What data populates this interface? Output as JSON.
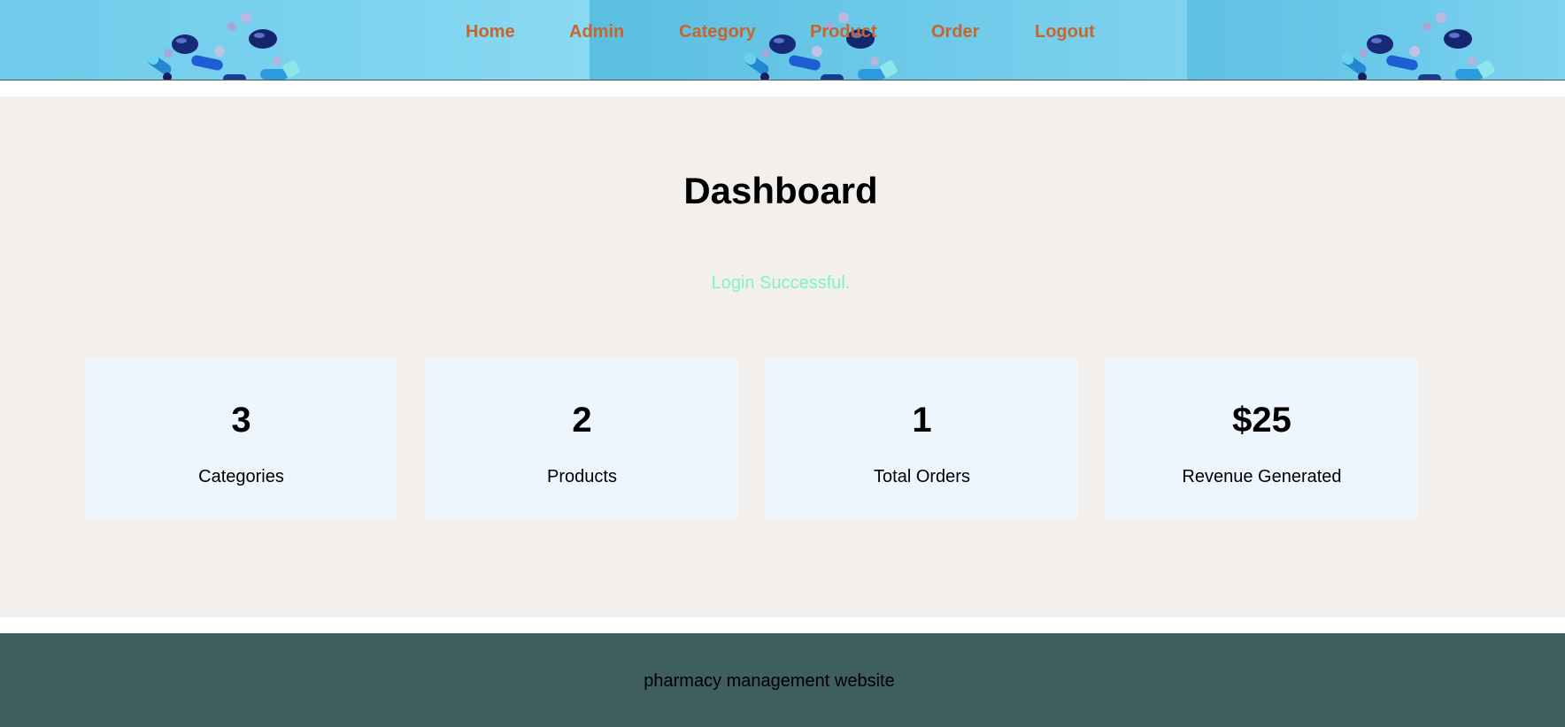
{
  "nav": {
    "items": [
      {
        "label": "Home"
      },
      {
        "label": "Admin"
      },
      {
        "label": "Category"
      },
      {
        "label": "Product"
      },
      {
        "label": "Order"
      },
      {
        "label": "Logout"
      }
    ],
    "link_color": "#c8652a"
  },
  "header": {
    "banner_image": "blue-pills-banner",
    "banner_color": "#7fd3ef"
  },
  "main": {
    "title": "Dashboard",
    "status_message": "Login Successful.",
    "status_color": "#7ef3c8",
    "background_color": "#f3efec",
    "stats": [
      {
        "value": "3",
        "label": "Categories"
      },
      {
        "value": "2",
        "label": "Products"
      },
      {
        "value": "1",
        "label": "Total Orders"
      },
      {
        "value": "$25",
        "label": "Revenue Generated"
      }
    ],
    "card_color": "#edf5fd"
  },
  "footer": {
    "text": "pharmacy management website",
    "background_color": "#3f5e5f"
  }
}
